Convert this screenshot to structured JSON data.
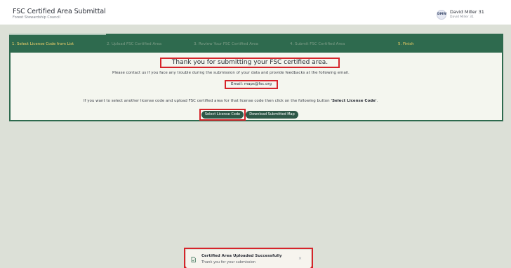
{
  "header": {
    "title": "FSC Certified Area Submittal",
    "subtitle": "Forest Stewardship Council",
    "user": {
      "initials": "DMW",
      "name": "David Miller 31",
      "sub": "David Miller 31"
    }
  },
  "stepper": {
    "current_step": 5,
    "steps": [
      {
        "label": "1.  Select License Code from List"
      },
      {
        "label": "2.  Upload FSC Certified Area"
      },
      {
        "label": "3.  Review Your FSC Certified Area"
      },
      {
        "label": "4.  Submit FSC Certified Area"
      },
      {
        "label": "5.  Finish"
      }
    ]
  },
  "main": {
    "thanks_title": "Thank you for submitting your FSC certified area.",
    "contact_text": "Please contact us if you face any trouble during the submission of your data and provide feedbacks at the following email.",
    "email_label": "Email: maps@fsc.org",
    "select_text_prefix": "If you want to select another license code and upload FSC certified area for that license code then click on the following button ",
    "select_text_bold": "'Select License Code'",
    "select_text_suffix": ".",
    "select_button": "Select License Code",
    "download_button": "Download Submitted Map"
  },
  "toast": {
    "title": "Certified Area Uploaded Successfully",
    "message": "Thank you for your submission",
    "icon": "document-check-icon",
    "close": "×"
  },
  "colors": {
    "brand_green": "#2e6a4e",
    "active_step": "#f5d36a",
    "highlight_red": "#d6242a",
    "background": "#dce0d7"
  }
}
